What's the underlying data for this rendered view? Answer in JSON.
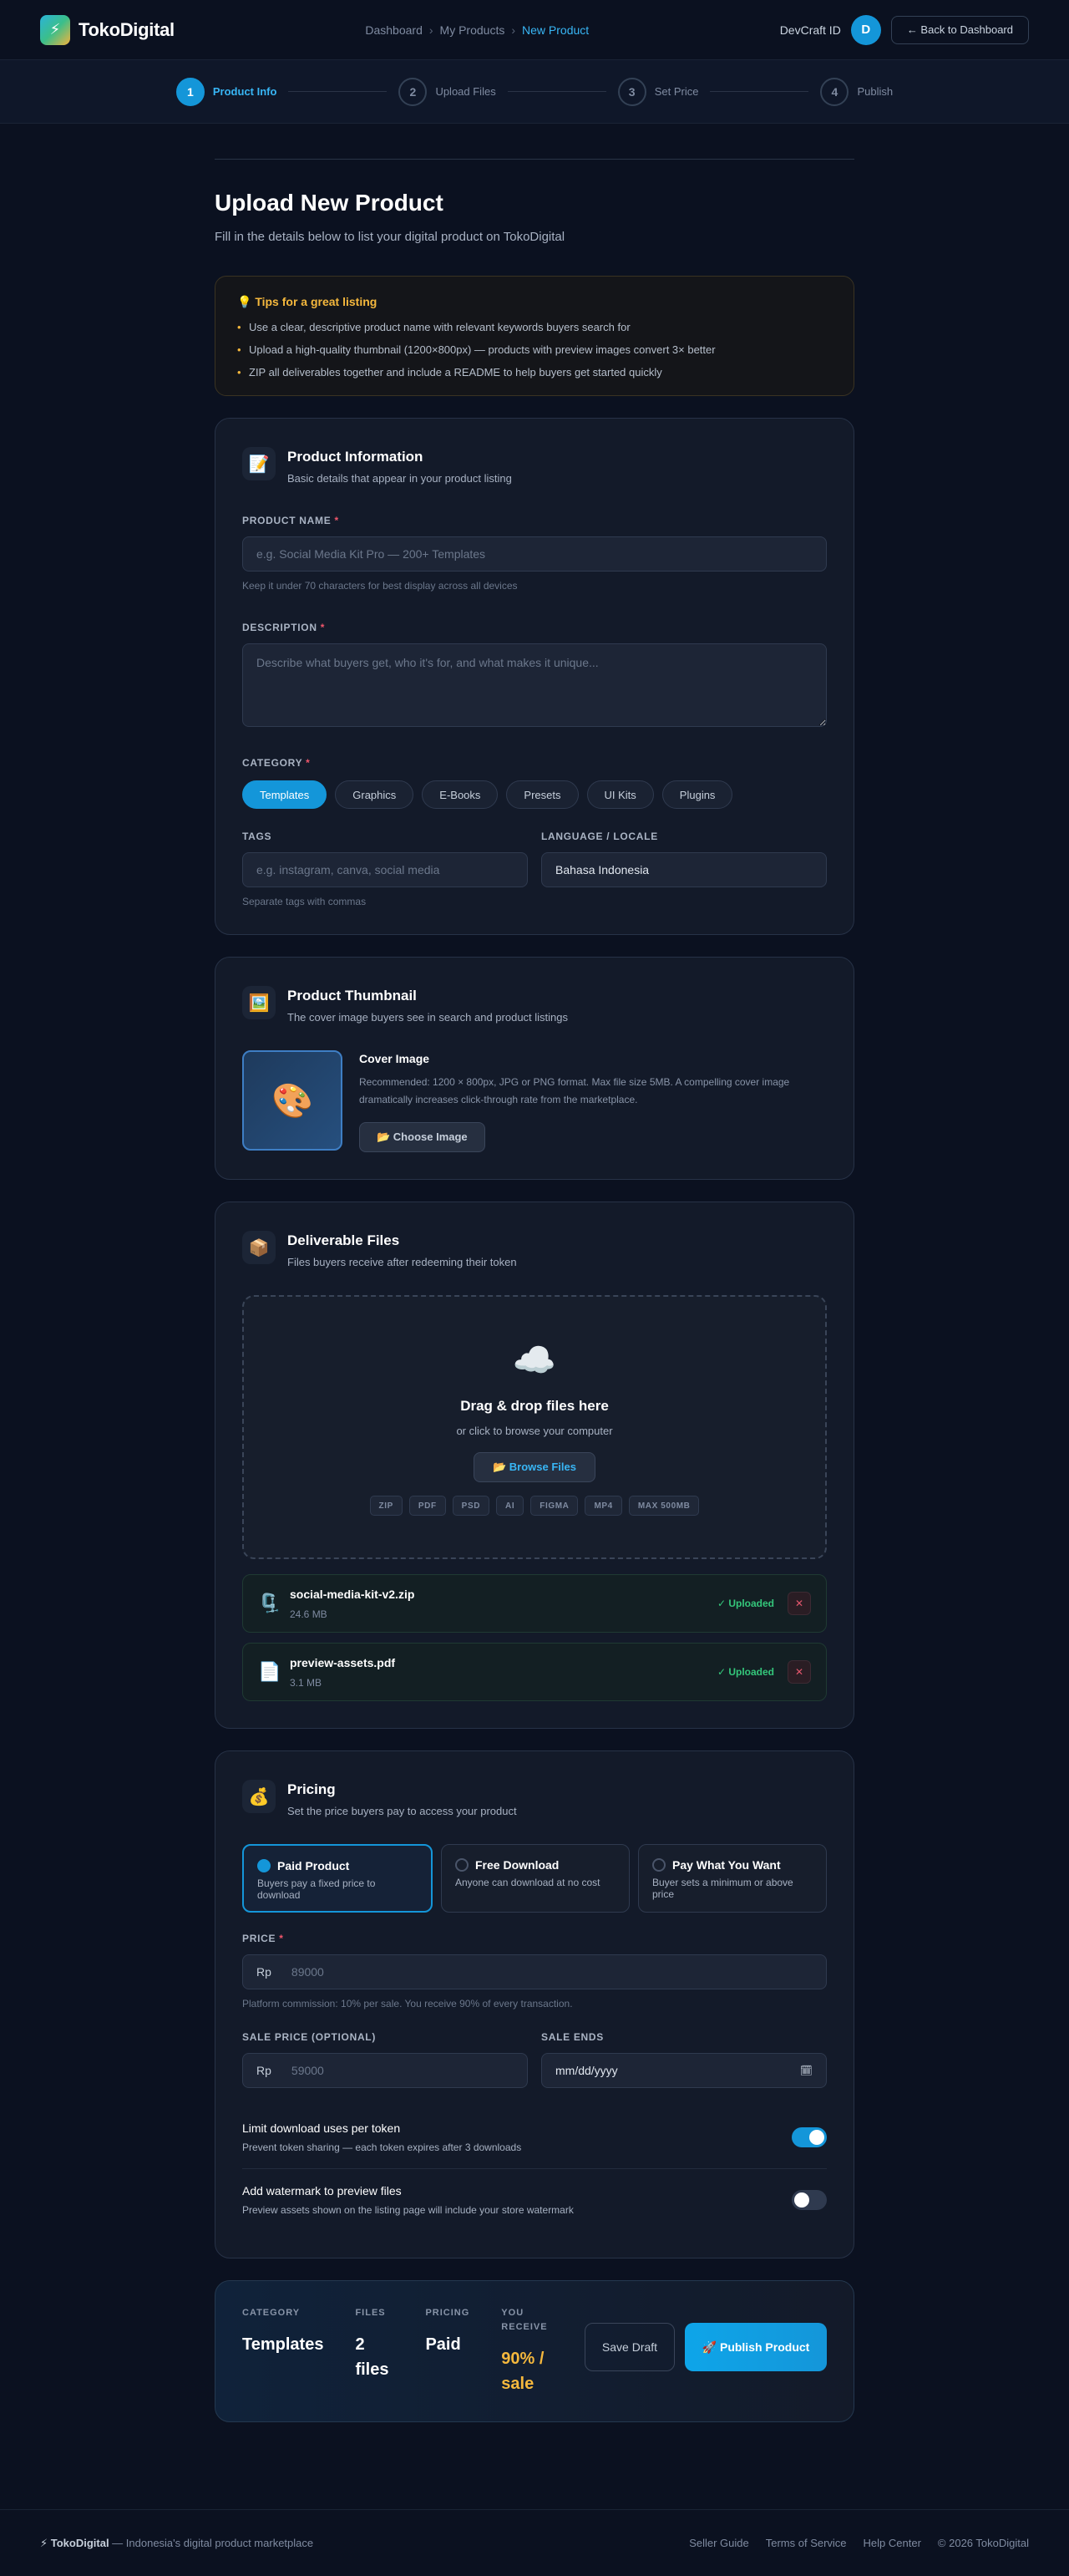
{
  "brand": {
    "name": "TokoDigital",
    "logo_icon": "⚡"
  },
  "breadcrumb": [
    "Dashboard",
    "My Products",
    "New Product"
  ],
  "user": {
    "name": "DevCraft ID",
    "initial": "D"
  },
  "header": {
    "back_label": "← Back to Dashboard"
  },
  "steps": [
    {
      "num": "1",
      "label": "Product Info"
    },
    {
      "num": "2",
      "label": "Upload Files"
    },
    {
      "num": "3",
      "label": "Set Price"
    },
    {
      "num": "4",
      "label": "Publish"
    }
  ],
  "page": {
    "title": "Upload New Product",
    "subtitle": "Fill in the details below to list your digital product on TokoDigital"
  },
  "tips": {
    "title": "💡 Tips for a great listing",
    "items": [
      "Use a clear, descriptive product name with relevant keywords buyers search for",
      "Upload a high-quality thumbnail (1200×800px) — products with preview images convert 3× better",
      "ZIP all deliverables together and include a README to help buyers get started quickly"
    ]
  },
  "info": {
    "icon": "📝",
    "title": "Product Information",
    "subtitle": "Basic details that appear in your product listing",
    "name_label": "Product Name",
    "name_placeholder": "e.g. Social Media Kit Pro — 200+ Templates",
    "name_hint": "Keep it under 70 characters for best display across all devices",
    "desc_label": "Description",
    "desc_placeholder": "Describe what buyers get, who it's for, and what makes it unique...",
    "category_label": "Category",
    "categories": [
      "Templates",
      "Graphics",
      "E-Books",
      "Presets",
      "UI Kits",
      "Plugins"
    ],
    "tags_label": "Tags",
    "tags_placeholder": "e.g. instagram, canva, social media",
    "tags_hint": "Separate tags with commas",
    "locale_label": "Language / Locale",
    "locale_value": "Bahasa Indonesia"
  },
  "thumbnail": {
    "icon": "🖼️",
    "title": "Product Thumbnail",
    "subtitle": "The cover image buyers see in search and product listings",
    "preview_icon": "🎨",
    "cover_title": "Cover Image",
    "cover_desc": "Recommended: 1200 × 800px, JPG or PNG format. Max file size 5MB. A compelling cover image dramatically increases click-through rate from the marketplace.",
    "choose_label": "📂 Choose Image"
  },
  "files": {
    "icon": "📦",
    "title": "Deliverable Files",
    "subtitle": "Files buyers receive after redeeming their token",
    "drop_icon": "☁️",
    "drop_title": "Drag & drop files here",
    "drop_sub": "or click to browse your computer",
    "browse_label": "📂 Browse Files",
    "formats": [
      "ZIP",
      "PDF",
      "PSD",
      "AI",
      "FIGMA",
      "MP4",
      "MAX 500MB"
    ],
    "uploaded": [
      {
        "icon": "🗜️",
        "name": "social-media-kit-v2.zip",
        "size": "24.6 MB",
        "status": "✓ Uploaded",
        "remove": "✕"
      },
      {
        "icon": "📄",
        "name": "preview-assets.pdf",
        "size": "3.1 MB",
        "status": "✓ Uploaded",
        "remove": "✕"
      }
    ]
  },
  "pricing": {
    "icon": "💰",
    "title": "Pricing",
    "subtitle": "Set the price buyers pay to access your product",
    "types": [
      {
        "title": "Paid Product",
        "desc": "Buyers pay a fixed price to download"
      },
      {
        "title": "Free Download",
        "desc": "Anyone can download at no cost"
      },
      {
        "title": "Pay What You Want",
        "desc": "Buyer sets a minimum or above price"
      }
    ],
    "price_label": "Price",
    "currency": "Rp",
    "price_placeholder": "89000",
    "price_hint": "Platform commission: 10% per sale. You receive 90% of every transaction.",
    "sale_label": "Sale Price (Optional)",
    "sale_placeholder": "59000",
    "ends_label": "Sale Ends",
    "ends_placeholder": "mm/dd/yyyy",
    "calendar_icon": "🗓",
    "toggles": [
      {
        "title": "Limit download uses per token",
        "desc": "Prevent token sharing — each token expires after 3 downloads",
        "on": true
      },
      {
        "title": "Add watermark to preview files",
        "desc": "Preview assets shown on the listing page will include your store watermark",
        "on": false
      }
    ]
  },
  "summary": {
    "category_label": "CATEGORY",
    "category_value": "Templates",
    "files_label": "FILES",
    "files_value": "2 files",
    "pricing_label": "PRICING",
    "pricing_value": "Paid",
    "receive_label": "YOU RECEIVE",
    "receive_value": "90% / sale",
    "draft_label": "Save Draft",
    "publish_label": "🚀 Publish Product"
  },
  "footer": {
    "brand": "⚡ TokoDigital",
    "tagline": " — Indonesia's digital product marketplace",
    "links": [
      "Seller Guide",
      "Terms of Service",
      "Help Center"
    ],
    "copyright": "© 2026 TokoDigital"
  }
}
